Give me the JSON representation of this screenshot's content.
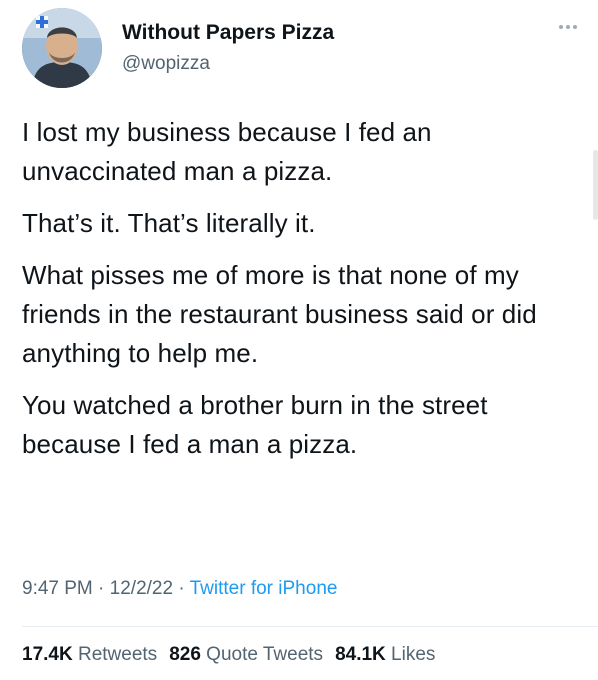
{
  "header": {
    "name": "Without Papers Pizza",
    "handle": "@wopizza",
    "avatar_icon": "person-photo-icon",
    "more_icon": "more-dots-icon"
  },
  "tweet": {
    "paragraphs": [
      "I lost my business because I fed an unvaccinated man a pizza.",
      "That’s it. That’s literally it.",
      "What pisses me of more is that none of my friends in the restaurant business said or did anything to help me.",
      "You watched a brother burn in the street because I fed a man a pizza."
    ]
  },
  "meta": {
    "time": "9:47 PM",
    "separator": " · ",
    "date": "12/2/22",
    "source": "Twitter for iPhone"
  },
  "stats": {
    "retweets_count": "17.4K",
    "retweets_label": "Retweets",
    "quotes_count": "826",
    "quotes_label": "Quote Tweets",
    "likes_count": "84.1K",
    "likes_label": "Likes"
  },
  "colors": {
    "text": "#0f1419",
    "secondary": "#536471",
    "link": "#1d9bf0",
    "divider": "#e6ecf0"
  }
}
